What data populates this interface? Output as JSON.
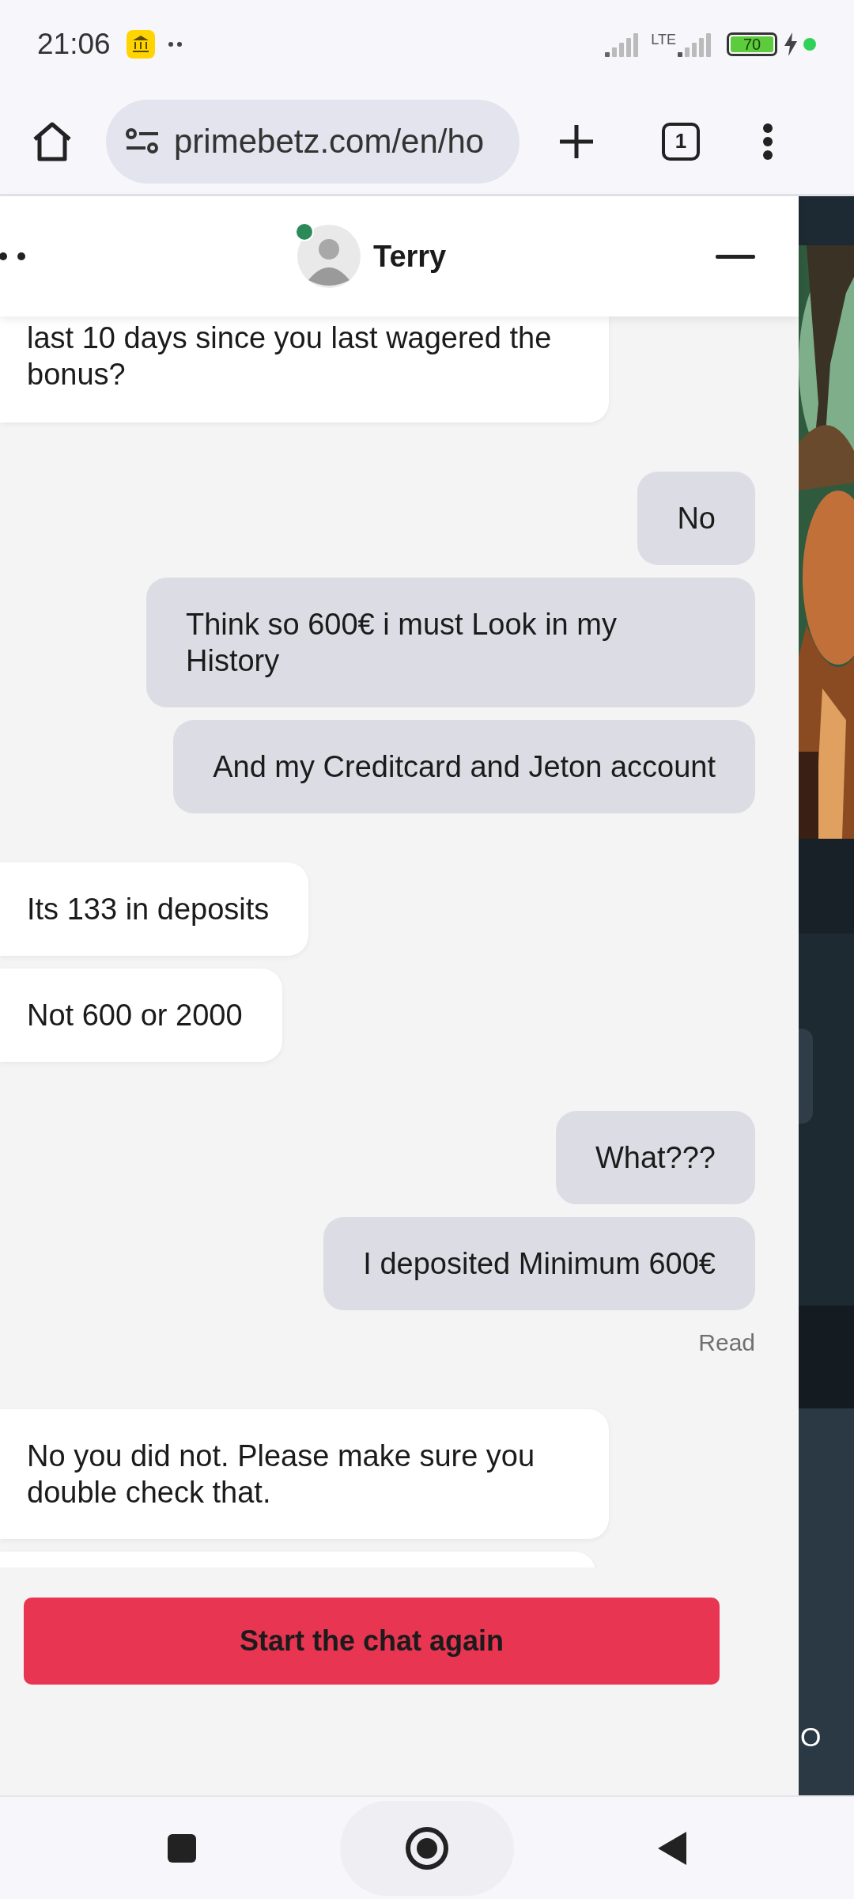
{
  "status_bar": {
    "time": "21:06",
    "network": "LTE",
    "battery": "70",
    "charging": true
  },
  "browser": {
    "url": "primebetz.com/en/ho",
    "tab_count": "1"
  },
  "chat": {
    "agent_name": "Terry",
    "agent_online": true,
    "messages": [
      {
        "outgoing": false,
        "kind": "cut_top",
        "text": "last 10 days since you last wagered the bonus?"
      },
      {
        "outgoing": true,
        "kind": "full",
        "text": "No"
      },
      {
        "outgoing": true,
        "kind": "full",
        "text": "Think so 600€ i must Look in my History"
      },
      {
        "outgoing": true,
        "kind": "full",
        "text": "And my Creditcard and Jeton account"
      },
      {
        "outgoing": false,
        "kind": "full",
        "text": "Its 133 in deposits"
      },
      {
        "outgoing": false,
        "kind": "full",
        "text": "Not 600 or 2000"
      },
      {
        "outgoing": true,
        "kind": "full",
        "text": "What???"
      },
      {
        "outgoing": true,
        "kind": "full",
        "text": "I deposited Minimum 600€",
        "receipt": "Read"
      },
      {
        "outgoing": false,
        "kind": "full",
        "text": "No you did not. Please make sure you double check that."
      },
      {
        "outgoing": false,
        "kind": "cut_bottom"
      }
    ],
    "restart_button": "Start the chat again"
  },
  "side_strip": {
    "edge_letter": "O"
  }
}
